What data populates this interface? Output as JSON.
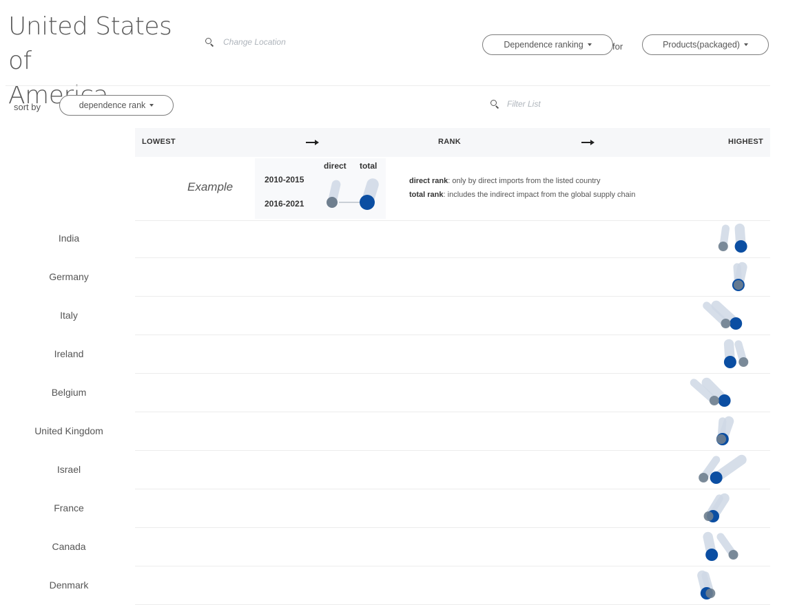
{
  "header": {
    "title_line1": "United States of",
    "title_line2": "America",
    "location_placeholder": "Change Location",
    "ranking_dropdown": "Dependence ranking",
    "for_label": "for",
    "product_dropdown": "Products(packaged)"
  },
  "controls": {
    "sort_by_label": "sort by",
    "sort_dropdown": "dependence rank",
    "filter_placeholder": "Filter List"
  },
  "rank_bar": {
    "lowest": "LOWEST",
    "rank": "RANK",
    "highest": "HIGHEST"
  },
  "example": {
    "label": "Example",
    "col_direct": "direct",
    "col_total": "total",
    "period_old": "2010-2015",
    "period_new": "2016-2021",
    "direct_title": "direct rank",
    "direct_desc": ": only by direct imports from the listed country",
    "total_title": "total rank",
    "total_desc": ": includes the indirect impact from the global supply chain"
  },
  "colors": {
    "direct": "#6f7f8f",
    "total": "#0b4ea2",
    "trail": "#cfd9e6"
  },
  "chart_data": {
    "type": "scatter",
    "x_axis": "rank (lowest to highest)",
    "xlim": [
      0,
      1
    ],
    "rows": [
      {
        "country": "India",
        "direct_old": 0.93,
        "direct_new": 0.926,
        "total_old": 0.952,
        "total_new": 0.954
      },
      {
        "country": "Germany",
        "direct_old": 0.948,
        "direct_new": 0.95,
        "total_old": 0.956,
        "total_new": 0.95
      },
      {
        "country": "Italy",
        "direct_old": 0.9,
        "direct_new": 0.93,
        "total_old": 0.915,
        "total_new": 0.946
      },
      {
        "country": "Ireland",
        "direct_old": 0.95,
        "direct_new": 0.958,
        "total_old": 0.935,
        "total_new": 0.937
      },
      {
        "country": "Belgium",
        "direct_old": 0.88,
        "direct_new": 0.912,
        "total_old": 0.9,
        "total_new": 0.928
      },
      {
        "country": "United Kingdom",
        "direct_old": 0.925,
        "direct_new": 0.923,
        "total_old": 0.935,
        "total_new": 0.925
      },
      {
        "country": "Israel",
        "direct_old": 0.915,
        "direct_new": 0.895,
        "total_old": 0.955,
        "total_new": 0.915
      },
      {
        "country": "France",
        "direct_old": 0.92,
        "direct_new": 0.903,
        "total_old": 0.928,
        "total_new": 0.91
      },
      {
        "country": "Canada",
        "direct_old": 0.922,
        "direct_new": 0.942,
        "total_old": 0.902,
        "total_new": 0.908
      },
      {
        "country": "Denmark",
        "direct_old": 0.898,
        "direct_new": 0.906,
        "total_old": 0.893,
        "total_new": 0.9
      }
    ]
  }
}
